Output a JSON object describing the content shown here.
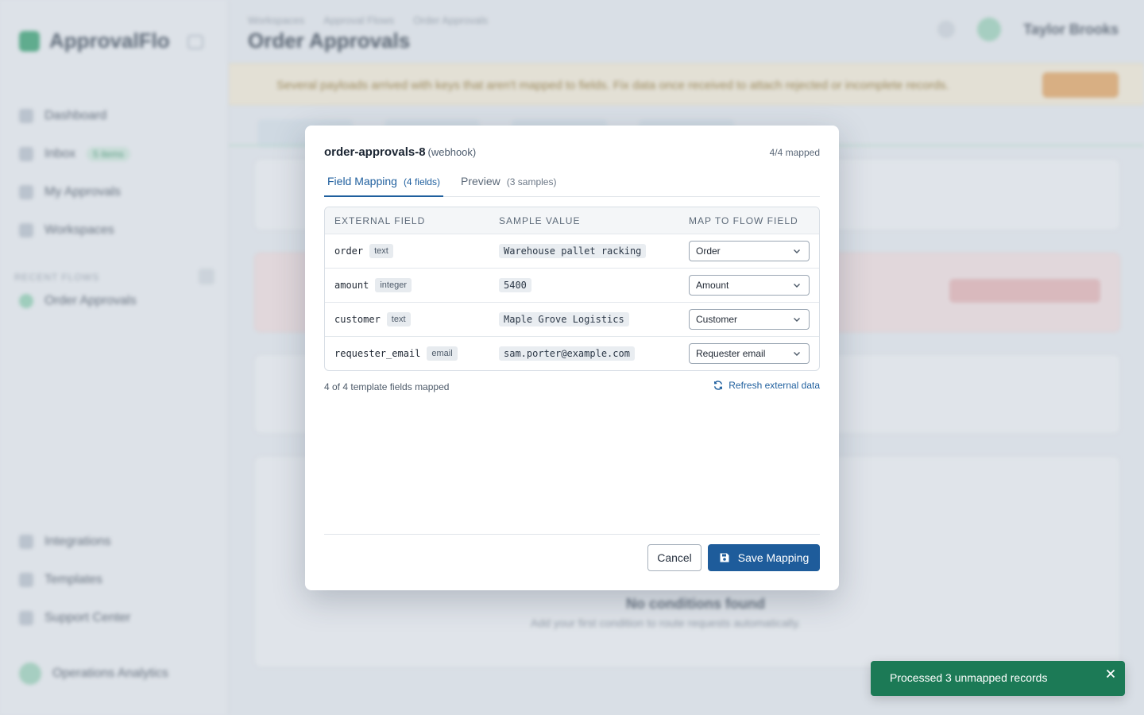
{
  "background": {
    "brand": "ApprovalFlo",
    "nav": [
      "Dashboard",
      "Inbox",
      "My Approvals",
      "Workspaces"
    ],
    "nav_badge": "5 items",
    "section_label": "Recent Flows",
    "flow_item": "Order Approvals",
    "bottom_nav": [
      "Integrations",
      "Templates",
      "Support Center"
    ],
    "user": "Operations Analytics",
    "breadcrumbs": [
      "Workspaces",
      "Approval Flows",
      "Order Approvals"
    ],
    "page_title": "Order Approvals",
    "top_user": "Taylor Brooks",
    "warning_text": "Several payloads arrived with keys that aren't mapped to fields. Fix data once received to attach rejected or incomplete records.",
    "empty_title": "No conditions found",
    "empty_sub": "Add your first condition to route requests automatically."
  },
  "modal": {
    "title": "order-approvals-8",
    "kind": "(webhook)",
    "mapped_status": "4/4 mapped",
    "tabs": [
      {
        "label": "Field Mapping",
        "count": "(4 fields)"
      },
      {
        "label": "Preview",
        "count": "(3 samples)"
      }
    ],
    "columns": [
      "EXTERNAL FIELD",
      "SAMPLE VALUE",
      "MAP TO FLOW FIELD"
    ],
    "rows": [
      {
        "field": "order",
        "type": "text",
        "sample": "Warehouse pallet racking",
        "mapped_to": "Order"
      },
      {
        "field": "amount",
        "type": "integer",
        "sample": "5400",
        "mapped_to": "Amount"
      },
      {
        "field": "customer",
        "type": "text",
        "sample": "Maple Grove Logistics",
        "mapped_to": "Customer"
      },
      {
        "field": "requester_email",
        "type": "email",
        "sample": "sam.porter@example.com",
        "mapped_to": "Requester email"
      }
    ],
    "footer_info": "4 of 4 template fields mapped",
    "refresh_label": "Refresh external data",
    "cancel_label": "Cancel",
    "save_label": "Save Mapping"
  },
  "toast": {
    "message": "Processed 3 unmapped records"
  },
  "colors": {
    "primary": "#1e5c9b",
    "toast_bg": "#1c7a56"
  }
}
